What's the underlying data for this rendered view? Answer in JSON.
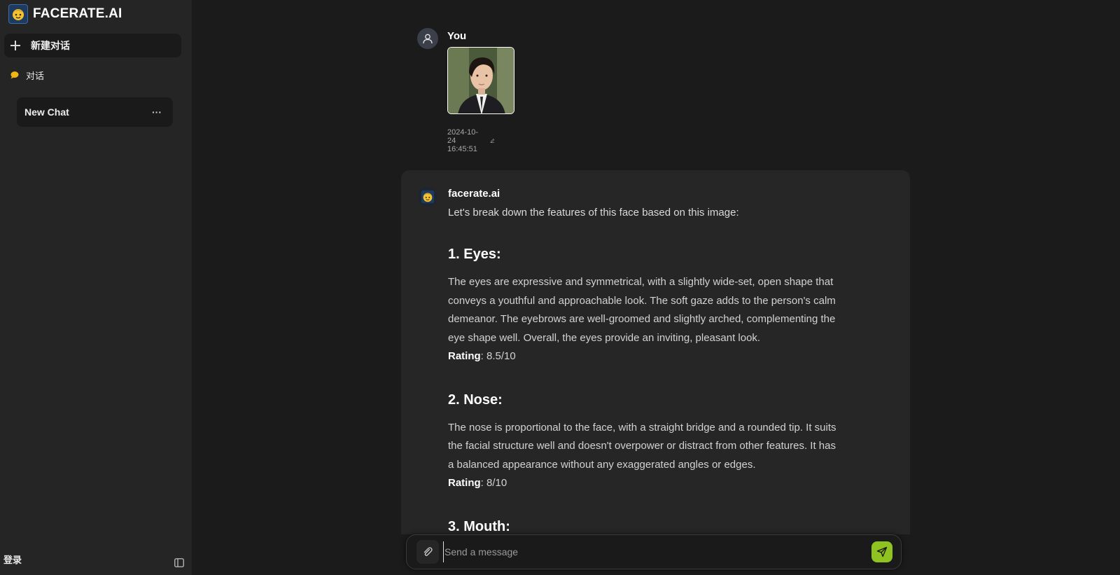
{
  "sidebar": {
    "brand": "FACERATE.AI",
    "new_chat_label": "新建对话",
    "section_label": "对话",
    "chat_items": [
      {
        "label": "New Chat",
        "more": "···"
      }
    ],
    "login_label": "登录"
  },
  "conversation": {
    "user_message": {
      "author": "You",
      "timestamp": "2024-10-24 16:45:51"
    },
    "bot_message": {
      "author": "facerate.ai",
      "intro": "Let's break down the features of this face based on this image:",
      "sections": [
        {
          "heading": "1. Eyes:",
          "lines": [
            "The eyes are expressive and symmetrical, with a slightly wide-set, open shape that",
            "conveys a youthful and approachable look. The soft gaze adds to the person's calm",
            "demeanor. The eyebrows are well-groomed and slightly arched, complementing the",
            "eye shape well. Overall, the eyes provide an inviting, pleasant look."
          ],
          "rating_label": "Rating",
          "rating_value": ": 8.5/10"
        },
        {
          "heading": "2. Nose:",
          "lines": [
            "The nose is proportional to the face, with a straight bridge and a rounded tip. It suits",
            "the facial structure well and doesn't overpower or distract from other features. It has",
            "a balanced appearance without any exaggerated angles or edges."
          ],
          "rating_label": "Rating",
          "rating_value": ": 8/10"
        },
        {
          "heading": "3. Mouth:"
        }
      ]
    }
  },
  "composer": {
    "placeholder": "Send a message"
  },
  "colors": {
    "accent": "#8fc31f",
    "sidebar_bg": "#252525",
    "main_bg": "#1b1b1b",
    "bubble_bg": "#262626"
  },
  "icons": [
    "facerate-logo-icon",
    "plus-icon",
    "chat-bubble-icon",
    "more-icon",
    "user-icon",
    "edit-icon",
    "paperclip-icon",
    "send-icon",
    "sidebar-toggle-icon"
  ]
}
